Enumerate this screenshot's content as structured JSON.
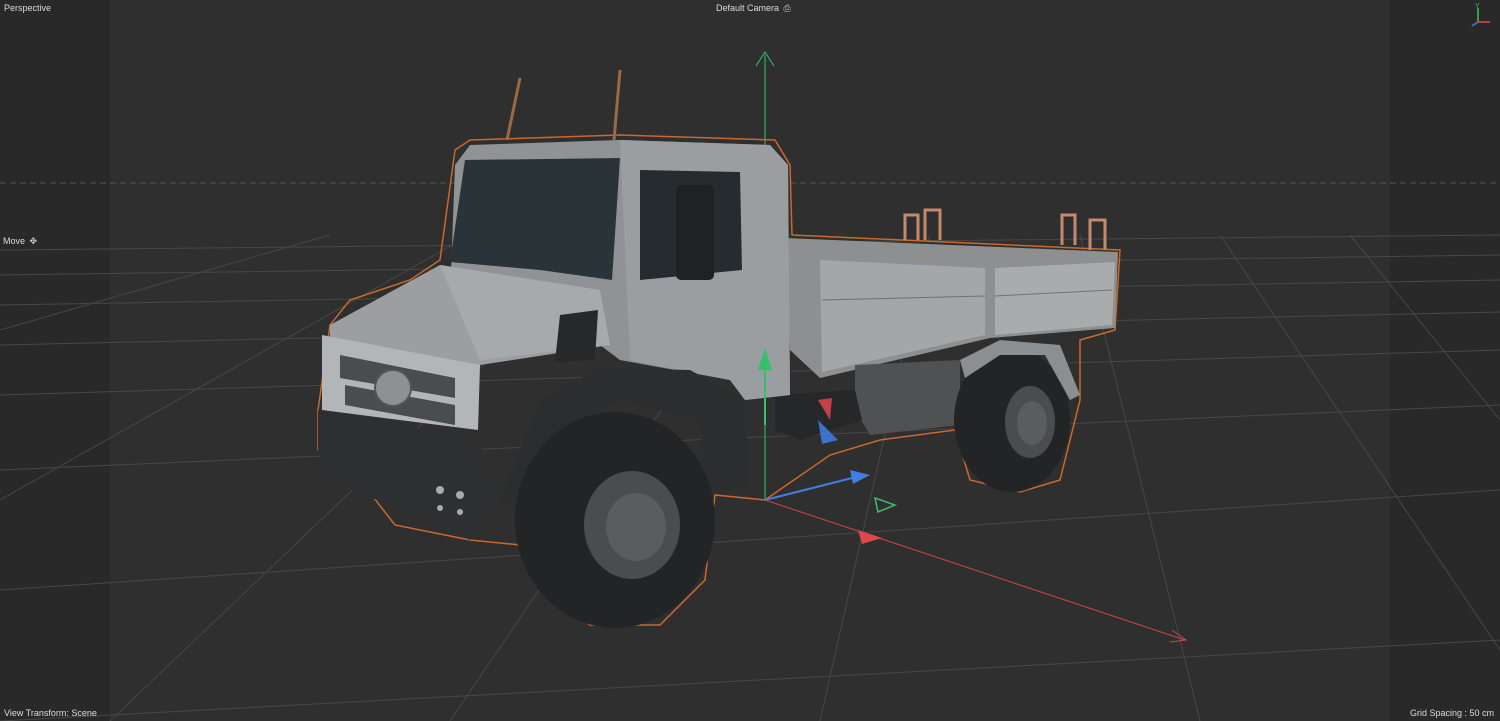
{
  "viewport": {
    "view_name": "Perspective",
    "camera_name": "Default Camera",
    "camera_icon": "camera-icon",
    "tool_name": "Move",
    "tool_icon": "move-icon",
    "view_transform": "View Transform: Scene",
    "grid_spacing": "Grid Spacing : 50 cm",
    "orientation_axes": {
      "y_label": "Y",
      "x_label": "X",
      "z_label": "Z"
    },
    "colors": {
      "x_axis": "#e0474c",
      "y_axis": "#3fcf6a",
      "z_axis": "#3f7fe0",
      "selection_outline": "#d8712e",
      "grid": "#4a4a4a"
    }
  },
  "scene": {
    "object": "truck-model",
    "gizmo": "move-gizmo"
  }
}
